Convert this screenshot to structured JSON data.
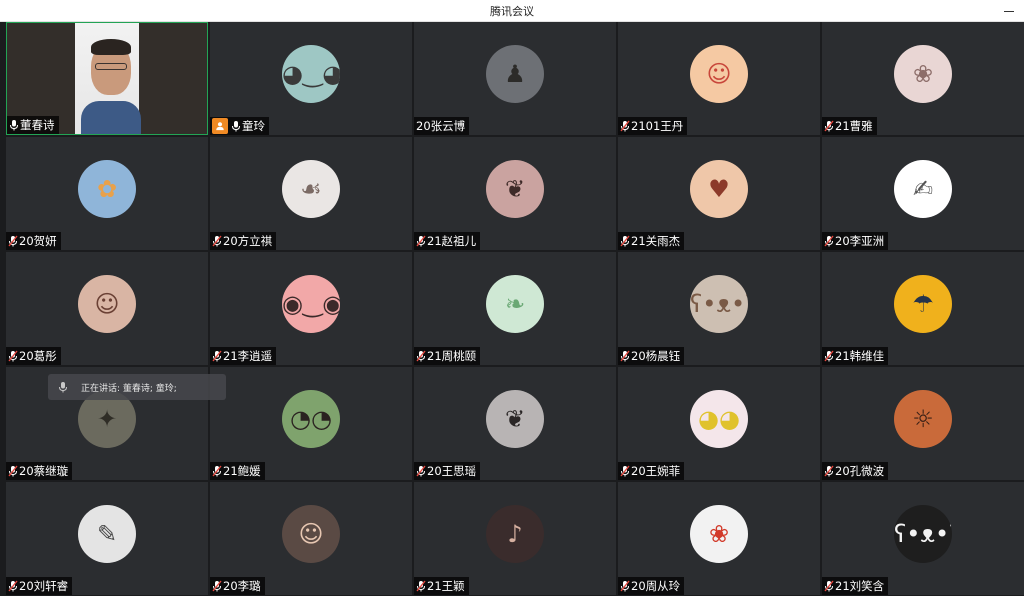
{
  "window": {
    "title": "腾讯会议"
  },
  "speaking": {
    "text": "正在讲话: 董春诗; 童玲;"
  },
  "participants": [
    {
      "name": "董春诗",
      "type": "video",
      "active": true,
      "mic": "on",
      "host": false
    },
    {
      "name": "童玲",
      "type": "avatar",
      "mic": "on",
      "host": true,
      "icon": "cartoon-girl-glasses-icon",
      "bg": "#9ec7c4",
      "fg": "#3a3a3a",
      "glyph": "◕‿◕"
    },
    {
      "name": "20张云博",
      "type": "avatar",
      "mic": "none",
      "host": false,
      "icon": "sunset-silhouette-icon",
      "bg": "#6d7075",
      "fg": "#2c2b29",
      "glyph": "♟"
    },
    {
      "name": "2101王丹",
      "type": "avatar",
      "mic": "muted",
      "host": false,
      "icon": "cartoon-girl-icon",
      "bg": "#f5c9a3",
      "fg": "#c8463a",
      "glyph": "☺"
    },
    {
      "name": "21曹雅",
      "type": "avatar",
      "mic": "muted",
      "host": false,
      "icon": "anime-girl-icon",
      "bg": "#e9d6d4",
      "fg": "#8d6e6a",
      "glyph": "❀"
    },
    {
      "name": "20贺妍",
      "type": "avatar",
      "mic": "muted",
      "host": false,
      "icon": "pomeranian-dog-icon",
      "bg": "#8fb5d9",
      "fg": "#e8a14b",
      "glyph": "✿"
    },
    {
      "name": "20方立祺",
      "type": "avatar",
      "mic": "muted",
      "host": false,
      "icon": "girl-photo-icon",
      "bg": "#eae6e4",
      "fg": "#7b6a64",
      "glyph": "☙"
    },
    {
      "name": "21赵祖儿",
      "type": "avatar",
      "mic": "muted",
      "host": false,
      "icon": "girl-photo-icon",
      "bg": "#caa3a0",
      "fg": "#3e2a28",
      "glyph": "❦"
    },
    {
      "name": "21关雨杰",
      "type": "avatar",
      "mic": "muted",
      "host": false,
      "icon": "heart-cookie-icon",
      "bg": "#efc7a9",
      "fg": "#8c3a2a",
      "glyph": "♥"
    },
    {
      "name": "20李亚洲",
      "type": "avatar",
      "mic": "muted",
      "host": false,
      "icon": "line-drawing-icon",
      "bg": "#ffffff",
      "fg": "#555555",
      "glyph": "✍"
    },
    {
      "name": "20葛彤",
      "type": "avatar",
      "mic": "muted",
      "host": false,
      "icon": "girl-photo-icon",
      "bg": "#d9b5a4",
      "fg": "#6a4034",
      "glyph": "☺"
    },
    {
      "name": "21李逍遥",
      "type": "avatar",
      "mic": "muted",
      "host": false,
      "icon": "patrick-star-icon",
      "bg": "#f2a8a8",
      "fg": "#3a2a2a",
      "glyph": "◉‿◉"
    },
    {
      "name": "21周桃颐",
      "type": "avatar",
      "mic": "muted",
      "host": false,
      "icon": "green-food-icon",
      "bg": "#cfe8d4",
      "fg": "#6aa874",
      "glyph": "❧"
    },
    {
      "name": "20杨晨钰",
      "type": "avatar",
      "mic": "muted",
      "host": false,
      "icon": "toy-bear-icon",
      "bg": "#cdbfb2",
      "fg": "#7a5a46",
      "glyph": "ʕ•ᴥ•ʔ"
    },
    {
      "name": "21韩维佳",
      "type": "avatar",
      "mic": "muted",
      "host": false,
      "icon": "cartoon-hat-girl-icon",
      "bg": "#f0b11c",
      "fg": "#26344a",
      "glyph": "☂"
    },
    {
      "name": "20蔡继璇",
      "type": "avatar",
      "mic": "muted",
      "host": false,
      "icon": "girl-photo-icon",
      "bg": "#6b6a5e",
      "fg": "#2f2d26",
      "glyph": "✦"
    },
    {
      "name": "21鲍媛",
      "type": "avatar",
      "mic": "muted",
      "host": false,
      "icon": "girl-sunglasses-icon",
      "bg": "#7fa36d",
      "fg": "#2a2220",
      "glyph": "◔◔"
    },
    {
      "name": "20王思瑶",
      "type": "avatar",
      "mic": "muted",
      "host": false,
      "icon": "girl-photo-icon",
      "bg": "#b8b4b4",
      "fg": "#2a2626",
      "glyph": "❦"
    },
    {
      "name": "20王婉菲",
      "type": "avatar",
      "mic": "muted",
      "host": false,
      "icon": "yellow-hood-character-icon",
      "bg": "#f4e6ea",
      "fg": "#e0c22c",
      "glyph": "◕◕"
    },
    {
      "name": "20孔微波",
      "type": "avatar",
      "mic": "muted",
      "host": false,
      "icon": "sunset-sea-icon",
      "bg": "#c96a3a",
      "fg": "#3a2016",
      "glyph": "☼"
    },
    {
      "name": "20刘轩睿",
      "type": "avatar",
      "mic": "muted",
      "host": false,
      "icon": "sketch-figure-icon",
      "bg": "#e4e4e4",
      "fg": "#4a4a4a",
      "glyph": "✎"
    },
    {
      "name": "20李璐",
      "type": "avatar",
      "mic": "muted",
      "host": false,
      "icon": "girl-photo-icon",
      "bg": "#5a4a44",
      "fg": "#e7c7b2",
      "glyph": "☺"
    },
    {
      "name": "21王颖",
      "type": "avatar",
      "mic": "muted",
      "host": false,
      "icon": "girl-singing-icon",
      "bg": "#3a2c2c",
      "fg": "#d6b0a0",
      "glyph": "♪"
    },
    {
      "name": "20周从玲",
      "type": "avatar",
      "mic": "muted",
      "host": false,
      "icon": "little-mermaid-icon",
      "bg": "#f2f2f2",
      "fg": "#d23a2a",
      "glyph": "❀"
    },
    {
      "name": "21刘笑含",
      "type": "avatar",
      "mic": "muted",
      "host": false,
      "icon": "white-alpaca-icon",
      "bg": "#1e1e1e",
      "fg": "#f4f4f4",
      "glyph": "ʕ•ᴥ•ʔ"
    }
  ]
}
